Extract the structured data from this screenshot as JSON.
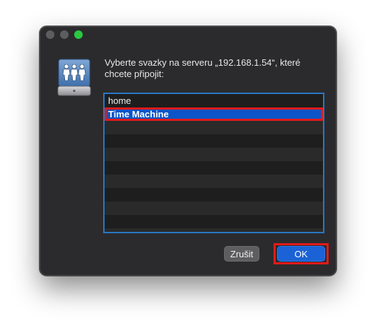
{
  "window": {
    "traffic_lights": [
      "close",
      "minimize",
      "zoom"
    ]
  },
  "dialog": {
    "icon": "network-server-icon",
    "prompt": "Vyberte svazky na serveru „192.168.1.54“, které chcete připojit:",
    "volumes": [
      {
        "label": "home",
        "selected": false
      },
      {
        "label": "Time Machine",
        "selected": true
      }
    ],
    "cancel_label": "Zrušit",
    "ok_label": "OK"
  },
  "colors": {
    "dialog_bg": "#2b2b2d",
    "selection": "#0b55c8",
    "highlight_box": "#e21a1a",
    "ok_button": "#1a62d6",
    "zoom_light": "#2ac940"
  }
}
